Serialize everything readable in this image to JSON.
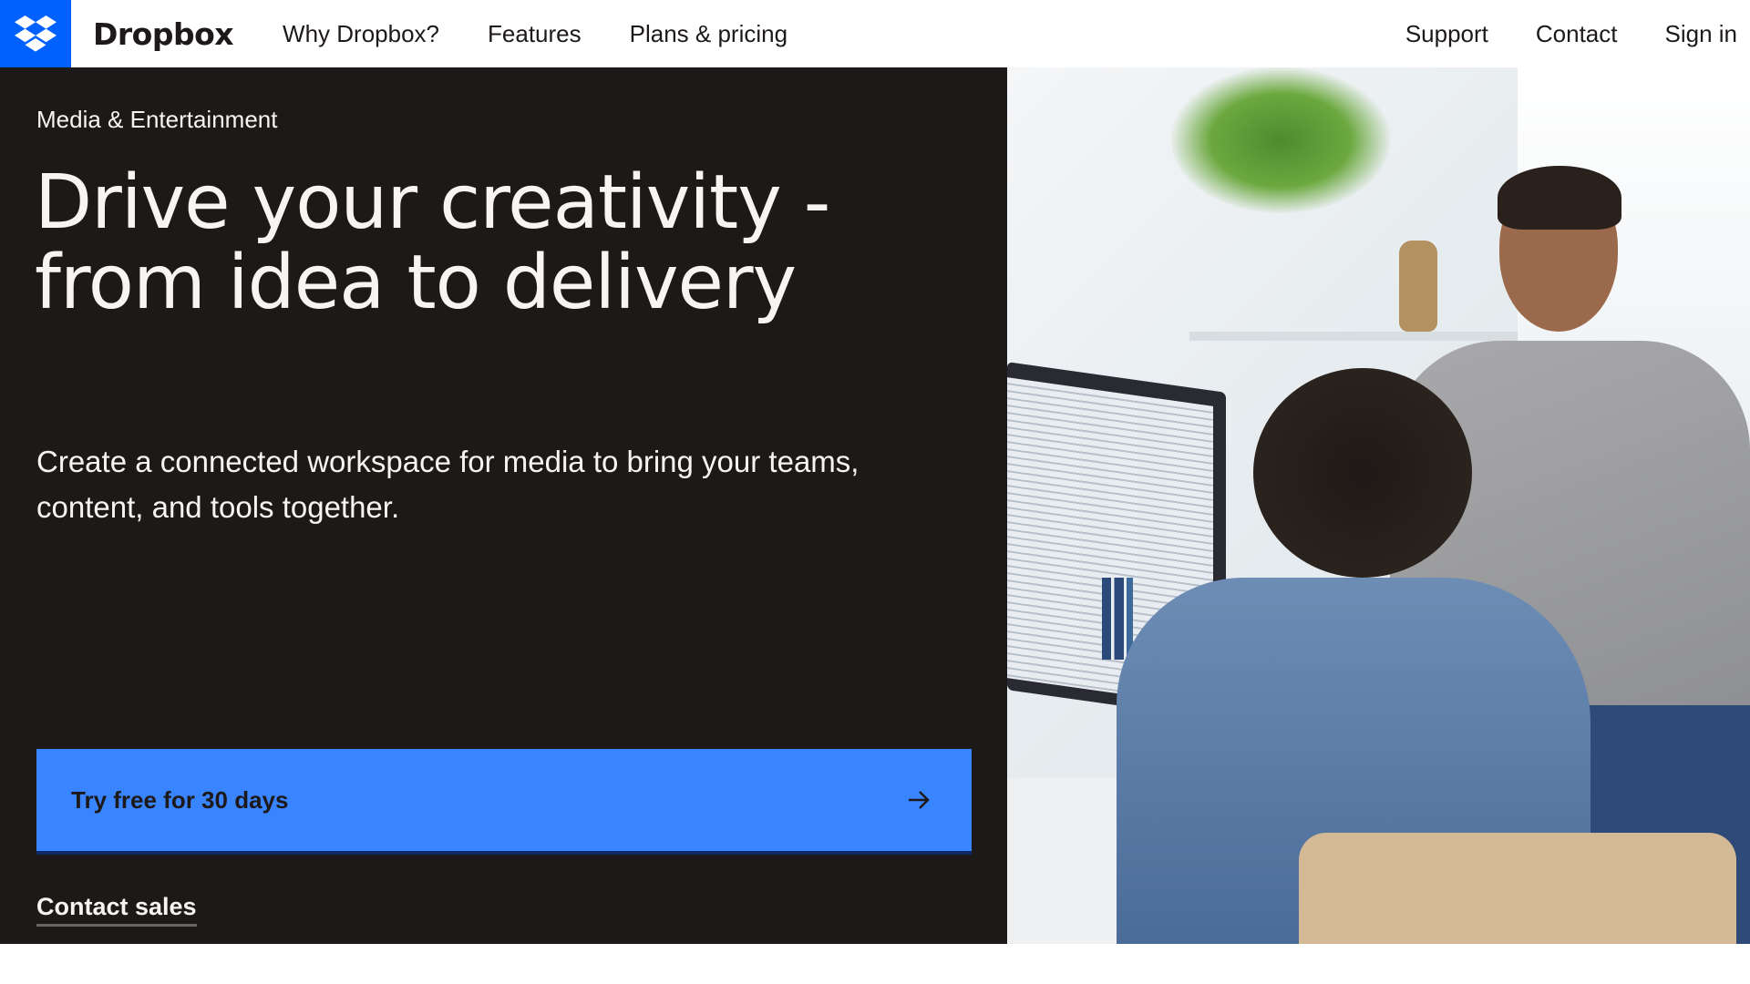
{
  "nav": {
    "brand": "Dropbox",
    "links": [
      "Why Dropbox?",
      "Features",
      "Plans & pricing"
    ],
    "right_links": [
      "Support",
      "Contact",
      "Sign in"
    ],
    "logo_icon": "dropbox-logo-icon",
    "logo_color": "#0061fe"
  },
  "hero": {
    "eyebrow": "Media & Entertainment",
    "headline": "Drive your creativity - from idea to delivery",
    "subheadline": "Create a connected workspace for media to bring your teams, content, and tools together.",
    "cta_label": "Try free for 30 days",
    "cta_icon": "arrow-right-icon",
    "cta_color": "#3984ff",
    "secondary_link": "Contact sales",
    "background_color": "#1e1919",
    "image_alt": "Two colleagues talking at a desk with a computer monitor"
  }
}
